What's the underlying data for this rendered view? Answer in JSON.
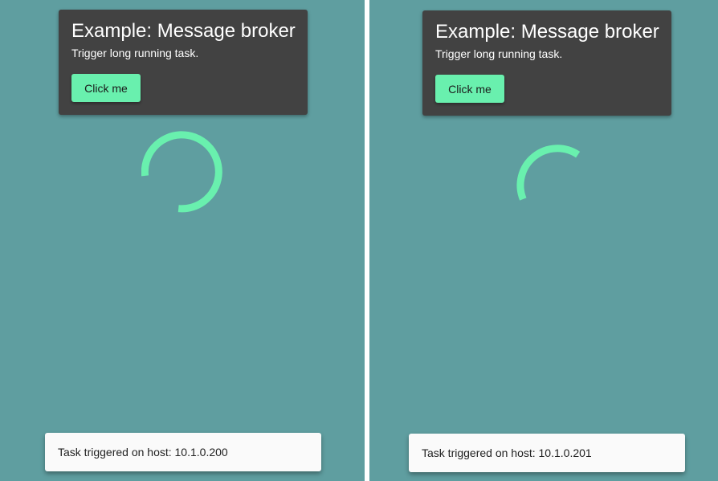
{
  "colors": {
    "background": "#5f9ea0",
    "card": "#424242",
    "accent": "#69f0ae",
    "snackbar": "#fafafa",
    "divider": "#ffffff"
  },
  "panels": [
    {
      "card": {
        "title": "Example: Message broker",
        "subtitle": "Trigger long running task.",
        "button_label": "Click me"
      },
      "spinner": {
        "icon": "loading-spinner-icon"
      },
      "snackbar": {
        "message": "Task triggered on host: 10.1.0.200"
      }
    },
    {
      "card": {
        "title": "Example: Message broker",
        "subtitle": "Trigger long running task.",
        "button_label": "Click me"
      },
      "spinner": {
        "icon": "loading-spinner-icon"
      },
      "snackbar": {
        "message": "Task triggered on host: 10.1.0.201"
      }
    }
  ]
}
